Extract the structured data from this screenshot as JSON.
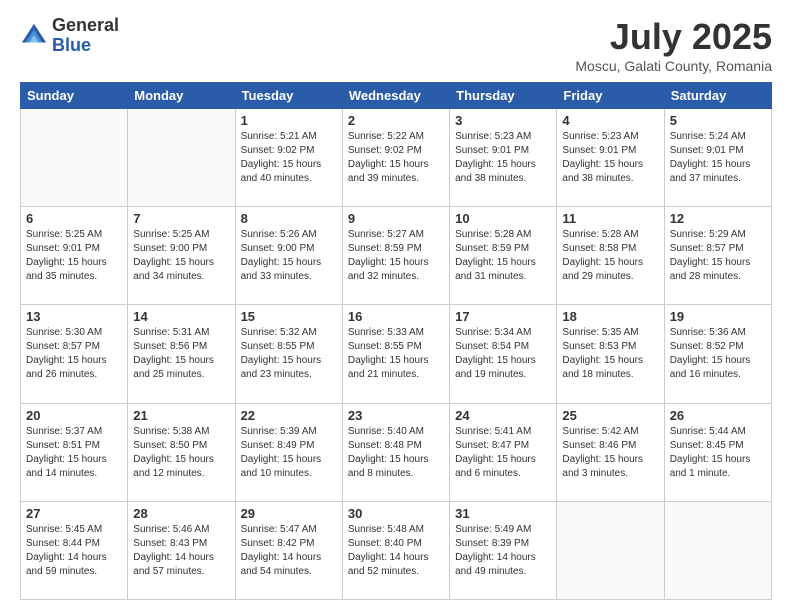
{
  "logo": {
    "general": "General",
    "blue": "Blue"
  },
  "title": {
    "month_year": "July 2025",
    "location": "Moscu, Galati County, Romania"
  },
  "weekdays": [
    "Sunday",
    "Monday",
    "Tuesday",
    "Wednesday",
    "Thursday",
    "Friday",
    "Saturday"
  ],
  "weeks": [
    [
      {
        "day": "",
        "info": ""
      },
      {
        "day": "",
        "info": ""
      },
      {
        "day": "1",
        "info": "Sunrise: 5:21 AM\nSunset: 9:02 PM\nDaylight: 15 hours and 40 minutes."
      },
      {
        "day": "2",
        "info": "Sunrise: 5:22 AM\nSunset: 9:02 PM\nDaylight: 15 hours and 39 minutes."
      },
      {
        "day": "3",
        "info": "Sunrise: 5:23 AM\nSunset: 9:01 PM\nDaylight: 15 hours and 38 minutes."
      },
      {
        "day": "4",
        "info": "Sunrise: 5:23 AM\nSunset: 9:01 PM\nDaylight: 15 hours and 38 minutes."
      },
      {
        "day": "5",
        "info": "Sunrise: 5:24 AM\nSunset: 9:01 PM\nDaylight: 15 hours and 37 minutes."
      }
    ],
    [
      {
        "day": "6",
        "info": "Sunrise: 5:25 AM\nSunset: 9:01 PM\nDaylight: 15 hours and 35 minutes."
      },
      {
        "day": "7",
        "info": "Sunrise: 5:25 AM\nSunset: 9:00 PM\nDaylight: 15 hours and 34 minutes."
      },
      {
        "day": "8",
        "info": "Sunrise: 5:26 AM\nSunset: 9:00 PM\nDaylight: 15 hours and 33 minutes."
      },
      {
        "day": "9",
        "info": "Sunrise: 5:27 AM\nSunset: 8:59 PM\nDaylight: 15 hours and 32 minutes."
      },
      {
        "day": "10",
        "info": "Sunrise: 5:28 AM\nSunset: 8:59 PM\nDaylight: 15 hours and 31 minutes."
      },
      {
        "day": "11",
        "info": "Sunrise: 5:28 AM\nSunset: 8:58 PM\nDaylight: 15 hours and 29 minutes."
      },
      {
        "day": "12",
        "info": "Sunrise: 5:29 AM\nSunset: 8:57 PM\nDaylight: 15 hours and 28 minutes."
      }
    ],
    [
      {
        "day": "13",
        "info": "Sunrise: 5:30 AM\nSunset: 8:57 PM\nDaylight: 15 hours and 26 minutes."
      },
      {
        "day": "14",
        "info": "Sunrise: 5:31 AM\nSunset: 8:56 PM\nDaylight: 15 hours and 25 minutes."
      },
      {
        "day": "15",
        "info": "Sunrise: 5:32 AM\nSunset: 8:55 PM\nDaylight: 15 hours and 23 minutes."
      },
      {
        "day": "16",
        "info": "Sunrise: 5:33 AM\nSunset: 8:55 PM\nDaylight: 15 hours and 21 minutes."
      },
      {
        "day": "17",
        "info": "Sunrise: 5:34 AM\nSunset: 8:54 PM\nDaylight: 15 hours and 19 minutes."
      },
      {
        "day": "18",
        "info": "Sunrise: 5:35 AM\nSunset: 8:53 PM\nDaylight: 15 hours and 18 minutes."
      },
      {
        "day": "19",
        "info": "Sunrise: 5:36 AM\nSunset: 8:52 PM\nDaylight: 15 hours and 16 minutes."
      }
    ],
    [
      {
        "day": "20",
        "info": "Sunrise: 5:37 AM\nSunset: 8:51 PM\nDaylight: 15 hours and 14 minutes."
      },
      {
        "day": "21",
        "info": "Sunrise: 5:38 AM\nSunset: 8:50 PM\nDaylight: 15 hours and 12 minutes."
      },
      {
        "day": "22",
        "info": "Sunrise: 5:39 AM\nSunset: 8:49 PM\nDaylight: 15 hours and 10 minutes."
      },
      {
        "day": "23",
        "info": "Sunrise: 5:40 AM\nSunset: 8:48 PM\nDaylight: 15 hours and 8 minutes."
      },
      {
        "day": "24",
        "info": "Sunrise: 5:41 AM\nSunset: 8:47 PM\nDaylight: 15 hours and 6 minutes."
      },
      {
        "day": "25",
        "info": "Sunrise: 5:42 AM\nSunset: 8:46 PM\nDaylight: 15 hours and 3 minutes."
      },
      {
        "day": "26",
        "info": "Sunrise: 5:44 AM\nSunset: 8:45 PM\nDaylight: 15 hours and 1 minute."
      }
    ],
    [
      {
        "day": "27",
        "info": "Sunrise: 5:45 AM\nSunset: 8:44 PM\nDaylight: 14 hours and 59 minutes."
      },
      {
        "day": "28",
        "info": "Sunrise: 5:46 AM\nSunset: 8:43 PM\nDaylight: 14 hours and 57 minutes."
      },
      {
        "day": "29",
        "info": "Sunrise: 5:47 AM\nSunset: 8:42 PM\nDaylight: 14 hours and 54 minutes."
      },
      {
        "day": "30",
        "info": "Sunrise: 5:48 AM\nSunset: 8:40 PM\nDaylight: 14 hours and 52 minutes."
      },
      {
        "day": "31",
        "info": "Sunrise: 5:49 AM\nSunset: 8:39 PM\nDaylight: 14 hours and 49 minutes."
      },
      {
        "day": "",
        "info": ""
      },
      {
        "day": "",
        "info": ""
      }
    ]
  ]
}
